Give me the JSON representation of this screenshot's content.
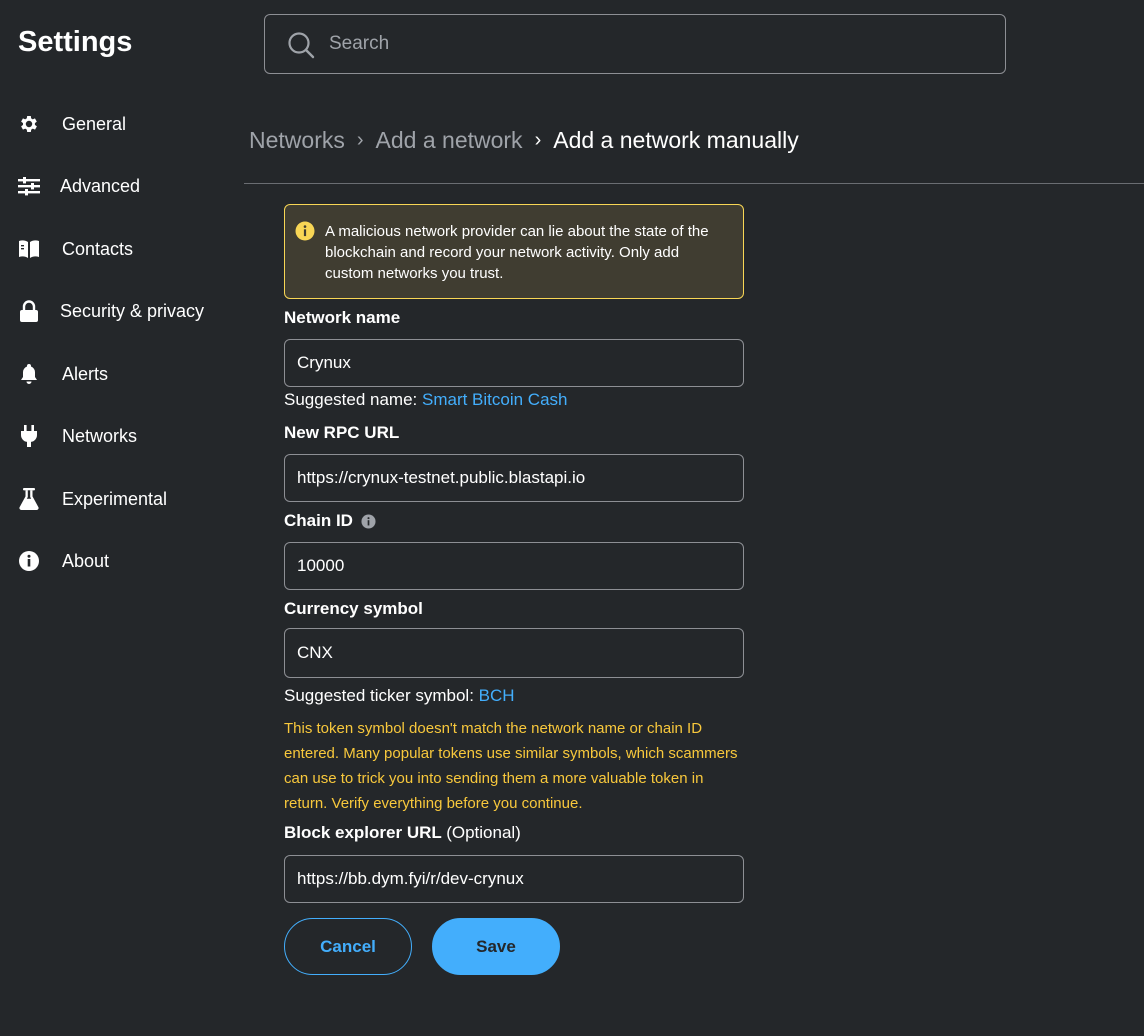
{
  "app": {
    "title": "Settings"
  },
  "search": {
    "placeholder": "Search"
  },
  "sidebar": {
    "items": [
      {
        "label": "General",
        "icon": "gear-icon"
      },
      {
        "label": "Advanced",
        "icon": "sliders-icon"
      },
      {
        "label": "Contacts",
        "icon": "book-icon"
      },
      {
        "label": "Security & privacy",
        "icon": "lock-icon"
      },
      {
        "label": "Alerts",
        "icon": "bell-icon"
      },
      {
        "label": "Networks",
        "icon": "plug-icon"
      },
      {
        "label": "Experimental",
        "icon": "flask-icon"
      },
      {
        "label": "About",
        "icon": "info-icon"
      }
    ]
  },
  "breadcrumb": {
    "items": [
      "Networks",
      "Add a network"
    ],
    "current": "Add a network manually"
  },
  "warning": {
    "text": "A malicious network provider can lie about the state of the blockchain and record your network activity. Only add custom networks you trust."
  },
  "form": {
    "network_name": {
      "label": "Network name",
      "value": "Crynux"
    },
    "suggested_name": {
      "prefix": "Suggested name:",
      "value": "Smart Bitcoin Cash"
    },
    "rpc_url": {
      "label": "New RPC URL",
      "value": "https://crynux-testnet.public.blastapi.io"
    },
    "chain_id": {
      "label": "Chain ID",
      "value": "10000"
    },
    "currency_symbol": {
      "label": "Currency symbol",
      "value": "CNX"
    },
    "suggested_ticker": {
      "prefix": "Suggested ticker symbol:",
      "value": "BCH"
    },
    "ticker_warning": "This token symbol doesn't match the network name or chain ID entered. Many popular tokens use similar symbols, which scammers can use to trick you into sending them a more valuable token in return. Verify everything before you continue.",
    "block_explorer": {
      "label": "Block explorer URL",
      "optional": "(Optional)",
      "value": "https://bb.dym.fyi/r/dev-crynux"
    }
  },
  "actions": {
    "cancel": "Cancel",
    "save": "Save"
  },
  "colors": {
    "background": "#24272a",
    "accent": "#43aefc",
    "warning_border": "#f8d655",
    "warning_text": "#f8c83c"
  }
}
